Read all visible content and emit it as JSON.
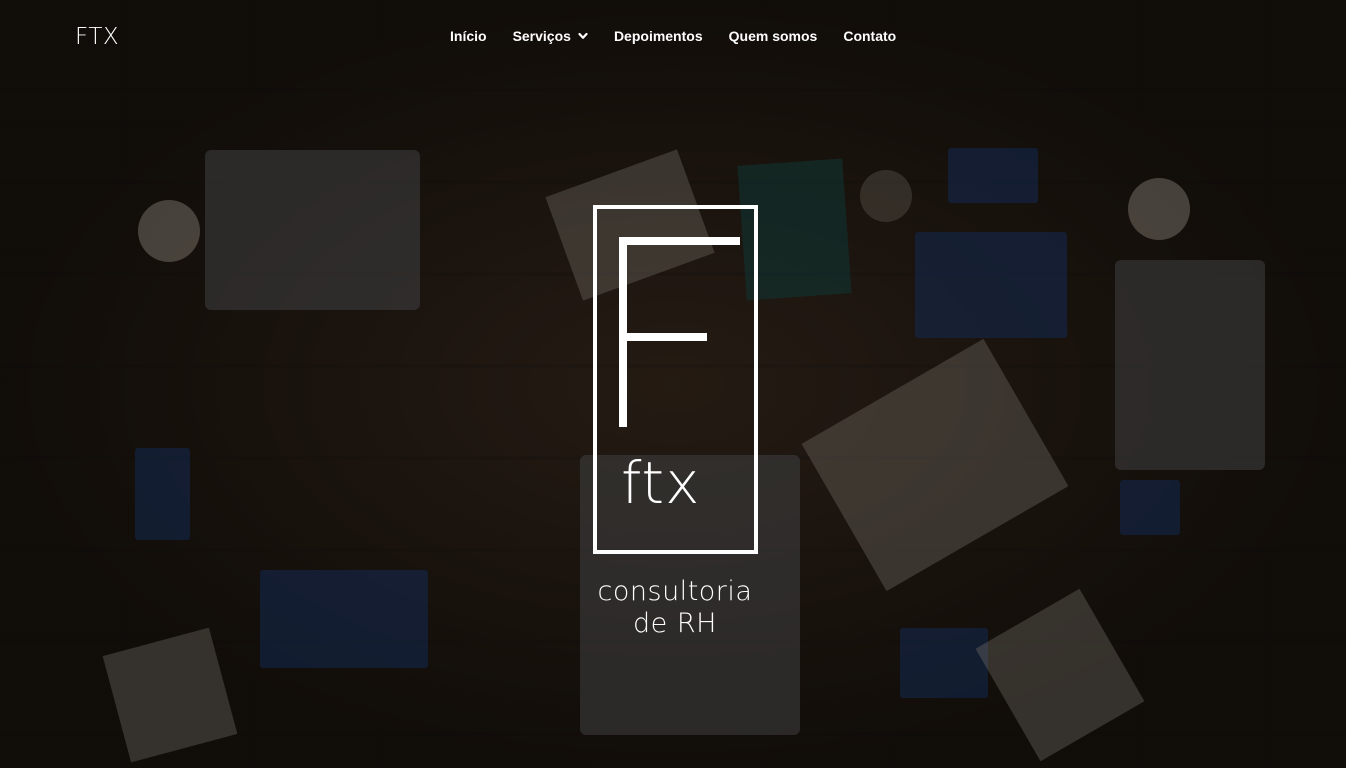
{
  "header": {
    "brand": "FTX",
    "nav": [
      {
        "label": "Início"
      },
      {
        "label": "Serviços",
        "has_dropdown": true
      },
      {
        "label": "Depoimentos"
      },
      {
        "label": "Quem somos"
      },
      {
        "label": "Contato"
      }
    ]
  },
  "hero": {
    "logo_text": "ftx",
    "tagline_line1": "consultoria",
    "tagline_line2": "de RH"
  },
  "colors": {
    "text": "#ffffff",
    "background": "#1c1510"
  }
}
